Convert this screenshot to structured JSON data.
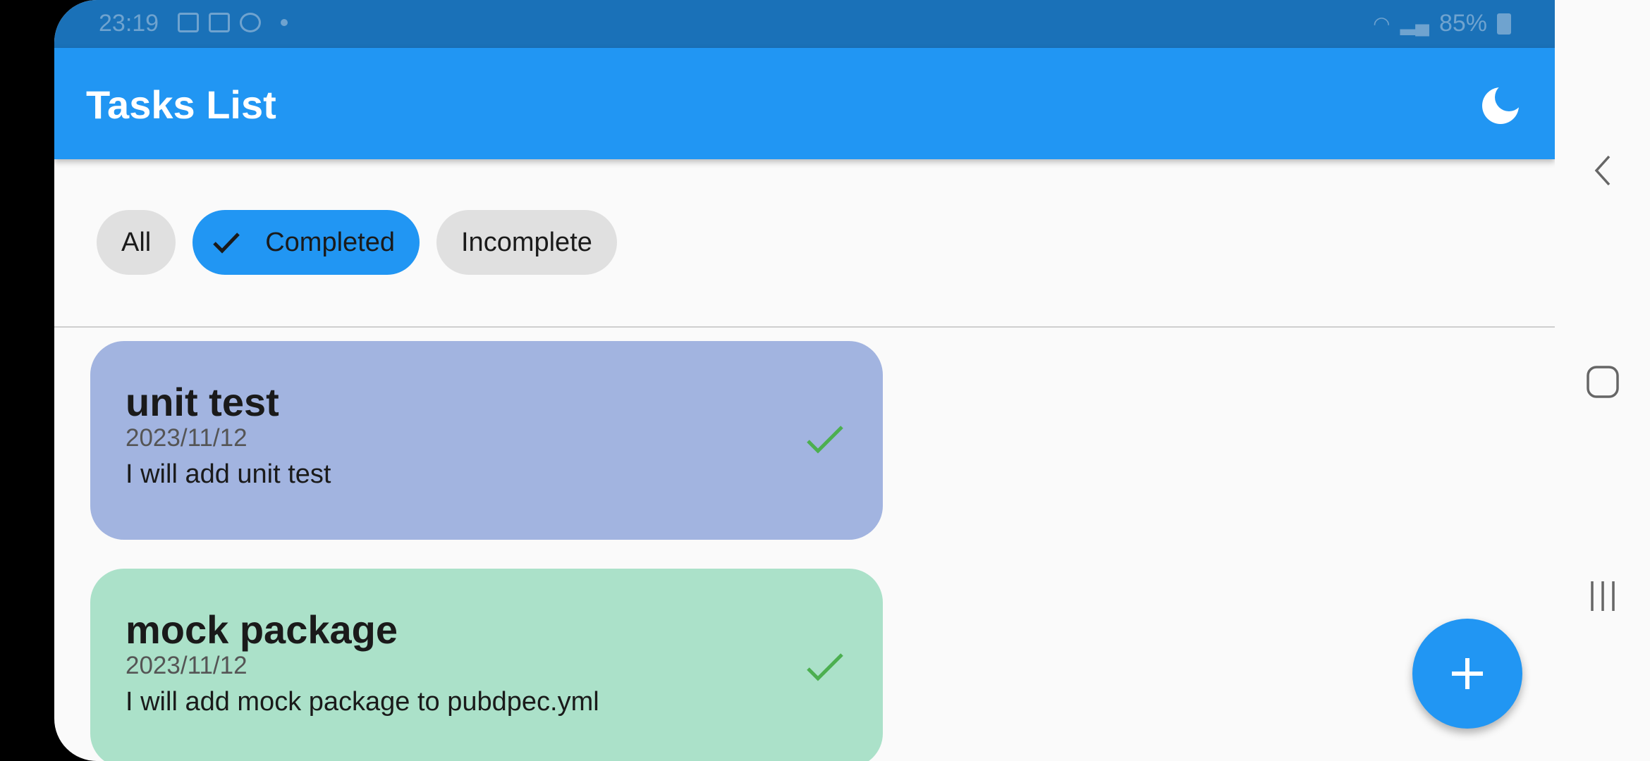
{
  "status_bar": {
    "time": "23:19",
    "battery": "85%"
  },
  "app_bar": {
    "title": "Tasks List",
    "theme_icon": "moon-icon"
  },
  "filters": [
    {
      "label": "All",
      "selected": false
    },
    {
      "label": "Completed",
      "selected": true
    },
    {
      "label": "Incomplete",
      "selected": false
    }
  ],
  "tasks": [
    {
      "title": "unit test",
      "date": "2023/11/12",
      "description": "I will add unit test",
      "completed": true,
      "color": "#a2b4e0"
    },
    {
      "title": "mock package",
      "date": "2023/11/12",
      "description": "I will add mock package to pubdpec.yml",
      "completed": true,
      "color": "#abe1c9"
    }
  ],
  "fab": {
    "icon": "plus-icon"
  },
  "colors": {
    "primary": "#2196f3",
    "status_bar": "#1a71b8",
    "check_green": "#4caf50"
  }
}
